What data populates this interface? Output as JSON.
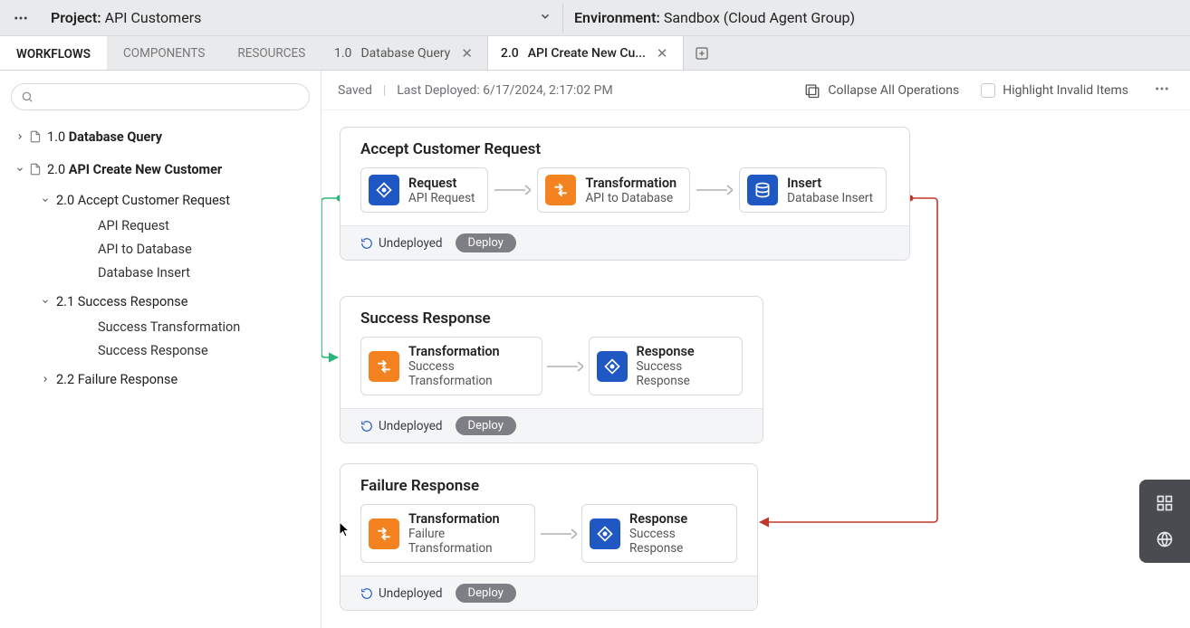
{
  "header": {
    "project_label": "Project",
    "project_name": "API Customers",
    "environment_label": "Environment",
    "environment_name": "Sandbox (Cloud Agent Group)"
  },
  "side_tabs": {
    "workflows": "WORKFLOWS",
    "components": "COMPONENTS",
    "resources": "RESOURCES"
  },
  "file_tabs": {
    "tab1_ver": "1.0",
    "tab1_name": "Database Query",
    "tab2_ver": "2.0",
    "tab2_name": "API Create New Cu..."
  },
  "tree": {
    "t1_prefix": "1.0 ",
    "t1_name": "Database Query",
    "t2_prefix": "2.0 ",
    "t2_name": "API Create New Customer",
    "t2a": "2.0 Accept Customer Request",
    "t2a1": "API Request",
    "t2a2": "API to Database",
    "t2a3": "Database Insert",
    "t2b": "2.1 Success Response",
    "t2b1": "Success Transformation",
    "t2b2": "Success Response",
    "t2c": "2.2 Failure Response"
  },
  "canvas_top": {
    "saved": "Saved",
    "deployed": "Last Deployed: 6/17/2024, 2:17:02 PM",
    "collapse": "Collapse All Operations",
    "highlight": "Highlight Invalid Items"
  },
  "ops": {
    "op1": {
      "title": "Accept Customer Request",
      "n1_t": "Request",
      "n1_s": "API Request",
      "n2_t": "Transformation",
      "n2_s": "API to Database",
      "n3_t": "Insert",
      "n3_s": "Database Insert"
    },
    "op2": {
      "title": "Success Response",
      "n1_t": "Transformation",
      "n1_s": "Success Transformation",
      "n2_t": "Response",
      "n2_s": "Success Response"
    },
    "op3": {
      "title": "Failure Response",
      "n1_t": "Transformation",
      "n1_s": "Failure Transformation",
      "n2_t": "Response",
      "n2_s": "Success Response"
    },
    "footer_status": "Undeployed",
    "footer_deploy": "Deploy"
  }
}
